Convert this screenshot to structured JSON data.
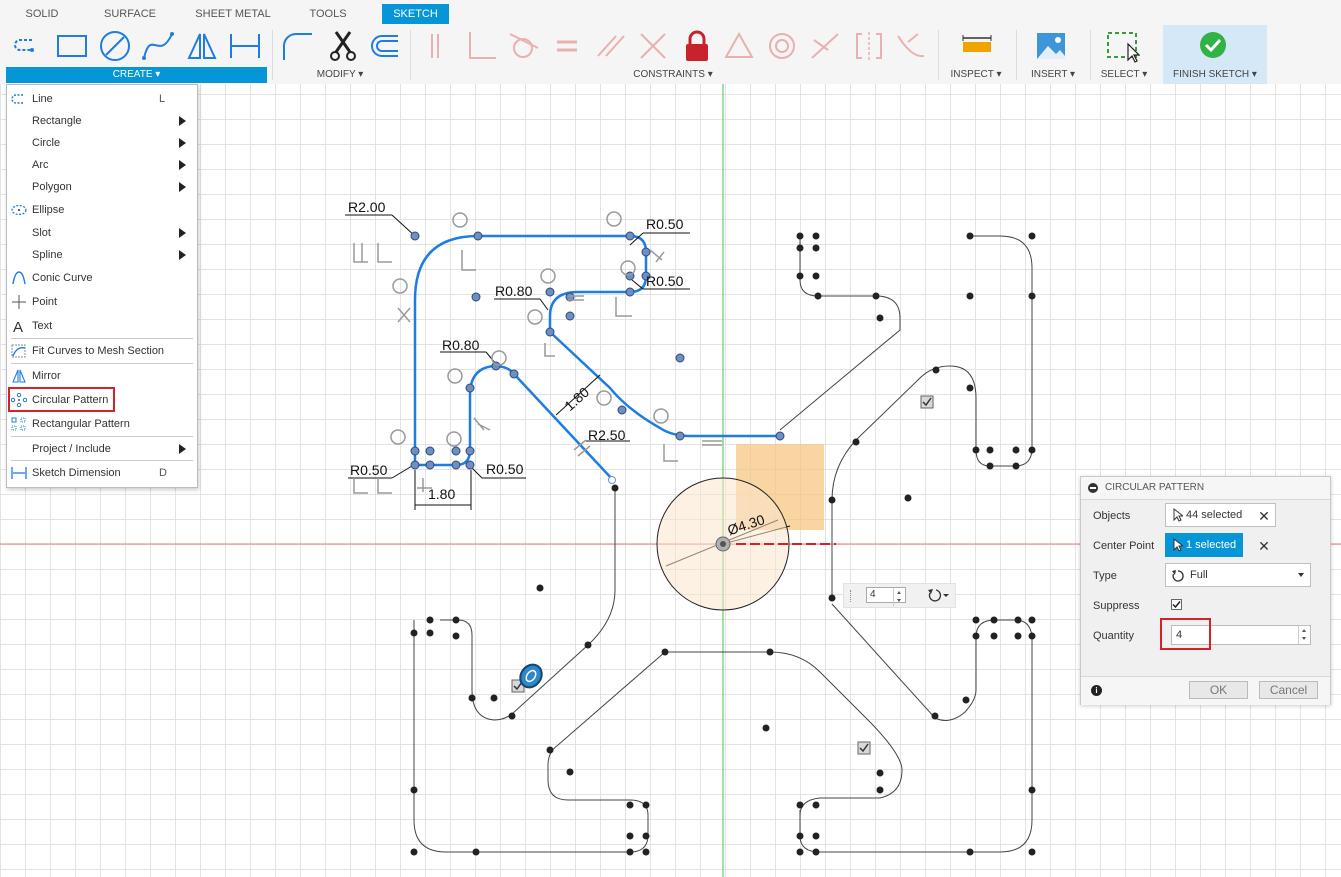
{
  "tabs": [
    "SOLID",
    "SURFACE",
    "SHEET METAL",
    "TOOLS",
    "SKETCH"
  ],
  "active_tab": "SKETCH",
  "groups": {
    "create": "CREATE ▾",
    "modify": "MODIFY ▾",
    "constraints": "CONSTRAINTS ▾",
    "inspect": "INSPECT ▾",
    "insert": "INSERT ▾",
    "select": "SELECT ▾",
    "finish": "FINISH SKETCH ▾"
  },
  "create_menu": {
    "items": [
      {
        "label": "Line",
        "shortcut": "L",
        "icon": "line-icon"
      },
      {
        "label": "Rectangle",
        "submenu": true,
        "icon": "none"
      },
      {
        "label": "Circle",
        "submenu": true,
        "icon": "none"
      },
      {
        "label": "Arc",
        "submenu": true,
        "icon": "none"
      },
      {
        "label": "Polygon",
        "submenu": true,
        "icon": "none"
      },
      {
        "label": "Ellipse",
        "icon": "ellipse-icon"
      },
      {
        "label": "Slot",
        "submenu": true,
        "icon": "none"
      },
      {
        "label": "Spline",
        "submenu": true,
        "icon": "none"
      },
      {
        "label": "Conic Curve",
        "icon": "conic-curve-icon"
      },
      {
        "label": "Point",
        "icon": "point-icon"
      },
      {
        "label": "Text",
        "icon": "text-icon"
      },
      {
        "label": "Fit Curves to Mesh Section",
        "icon": "fit-curves-icon"
      },
      {
        "label": "Mirror",
        "icon": "mirror-icon"
      },
      {
        "label": "Circular Pattern",
        "icon": "circular-pattern-icon"
      },
      {
        "label": "Rectangular Pattern",
        "icon": "rectangular-pattern-icon"
      },
      {
        "label": "Project / Include",
        "submenu": true,
        "icon": "none"
      },
      {
        "label": "Sketch Dimension",
        "shortcut": "D",
        "icon": "sketch-dimension-icon"
      }
    ]
  },
  "dimensions": {
    "r200": "R2.00",
    "r050_a": "R0.50",
    "r050_b": "R0.50",
    "r080_a": "R0.80",
    "r080_b": "R0.80",
    "d180_diag": "1.80",
    "r250": "R2.50",
    "r050_c": "R0.50",
    "r050_d": "R0.50",
    "d180_h": "1.80",
    "dia430": "Ø4.30"
  },
  "inline_quantity": "4",
  "dialog": {
    "title": "CIRCULAR PATTERN",
    "objects_label": "Objects",
    "objects_value": "44 selected",
    "center_label": "Center Point",
    "center_value": "1 selected",
    "type_label": "Type",
    "type_value": "Full",
    "suppress_label": "Suppress",
    "suppress_checked": true,
    "quantity_label": "Quantity",
    "quantity_value": "4",
    "ok": "OK",
    "cancel": "Cancel"
  },
  "colors": {
    "accent": "#0696d7",
    "highlight_red": "#d3222a",
    "selected_curve": "#1f7ce3",
    "x_axis": "#d9534f",
    "y_axis": "#3bbf3b"
  }
}
